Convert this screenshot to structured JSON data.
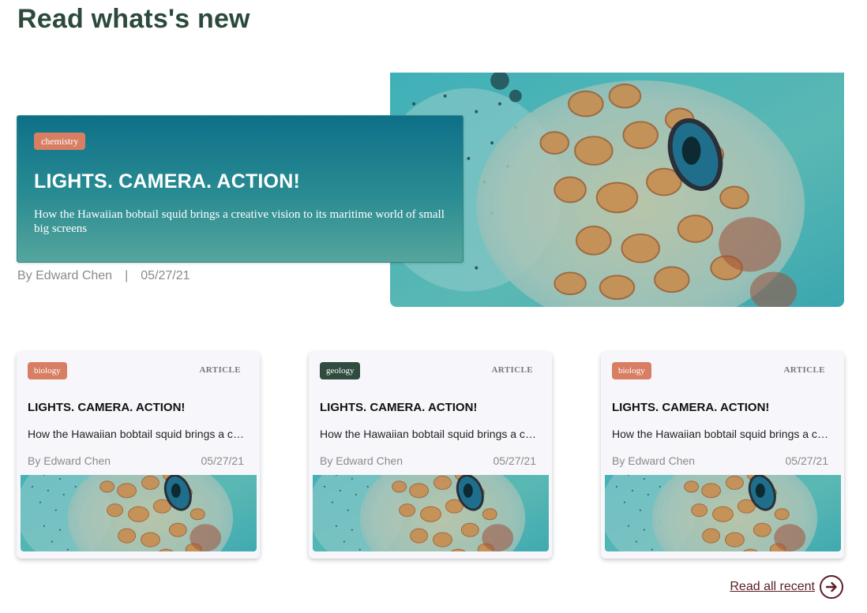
{
  "page": {
    "title": "Read whats's new"
  },
  "featured": {
    "tag": "chemistry",
    "title": "LIGHTS. CAMERA. ACTION!",
    "description": "How the Hawaiian bobtail squid brings a creative vision to its maritime world of small big screens",
    "author": "By Edward Chen",
    "separator": "|",
    "date": "05/27/21",
    "image_icon": "squid-photo"
  },
  "cards": [
    {
      "tag": "biology",
      "type": "ARTICLE",
      "title": "LIGHTS. CAMERA. ACTION!",
      "excerpt": "How the Hawaiian bobtail squid brings a creative vision to its maritime world of small big screens",
      "author": "By Edward Chen",
      "date": "05/27/21"
    },
    {
      "tag": "geology",
      "type": "ARTICLE",
      "title": "LIGHTS. CAMERA. ACTION!",
      "excerpt": "How the Hawaiian bobtail squid brings a creative vision to its maritime world of small big screens",
      "author": "By Edward Chen",
      "date": "05/27/21"
    },
    {
      "tag": "biology",
      "type": "ARTICLE",
      "title": "LIGHTS. CAMERA. ACTION!",
      "excerpt": "How the Hawaiian bobtail squid brings a creative vision to its maritime world of small big screens",
      "author": "By Edward Chen",
      "date": "05/27/21"
    }
  ],
  "footer": {
    "read_all_label": "Read all recent",
    "arrow_icon": "arrow-right-circle-icon"
  },
  "colors": {
    "title": "#2b4a3c",
    "tag_orange": "#d87e63",
    "tag_dark_green": "#2f4c3f",
    "hero_gradient_top": "#0e7088",
    "hero_gradient_bottom": "#56a59d",
    "link": "#5a1e24"
  }
}
